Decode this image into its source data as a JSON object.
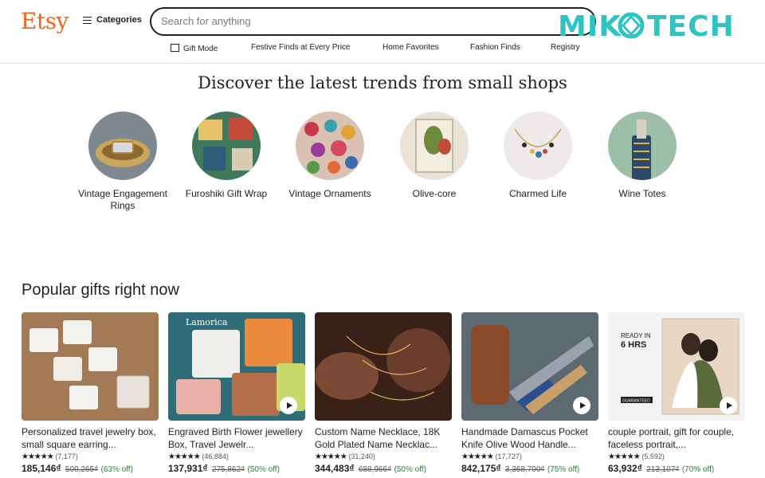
{
  "header": {
    "logo": "Etsy",
    "categories_label": "Categories",
    "search_placeholder": "Search for anything",
    "overlay_brand": "MIKO TECH"
  },
  "nav": {
    "items": [
      "Gift Mode",
      "Festive Finds at Every Price",
      "Home Favorites",
      "Fashion Finds",
      "Registry"
    ]
  },
  "trends": {
    "title": "Discover the latest trends from small shops",
    "items": [
      {
        "label": "Vintage Engagement Rings"
      },
      {
        "label": "Furoshiki Gift Wrap"
      },
      {
        "label": "Vintage Ornaments"
      },
      {
        "label": "Olive-core"
      },
      {
        "label": "Charmed Life"
      },
      {
        "label": "Wine Totes"
      }
    ]
  },
  "popular": {
    "title": "Popular gifts right now",
    "cards": [
      {
        "title": "Personalized travel jewelry box, small square earring...",
        "stars": "★★★★★",
        "reviews": "(7,177)",
        "price": "185,146₫",
        "was": "500,265₫",
        "off": "(63% off)",
        "has_video": false
      },
      {
        "title": "Engraved Birth Flower jewellery Box, Travel Jewelr...",
        "stars": "★★★★★",
        "reviews": "(46,884)",
        "price": "137,931₫",
        "was": "275,862₫",
        "off": "(50% off)",
        "has_video": true
      },
      {
        "title": "Custom Name Necklace, 18K Gold Plated Name Necklac...",
        "stars": "★★★★★",
        "reviews": "(31,240)",
        "price": "344,483₫",
        "was": "688,966₫",
        "off": "(50% off)",
        "has_video": false
      },
      {
        "title": "Handmade Damascus Pocket Knife Olive Wood Handle...",
        "stars": "★★★★★",
        "reviews": "(17,727)",
        "price": "842,175₫",
        "was": "3,368,700₫",
        "off": "(75% off)",
        "has_video": true
      },
      {
        "title": "couple portrait, gift for couple, faceless portrait,...",
        "stars": "★★★★★",
        "reviews": "(5,592)",
        "price": "63,932₫",
        "was": "213,107₫",
        "off": "(70% off)",
        "has_video": true
      }
    ]
  },
  "image_text": {
    "lamorica": "Lamorica",
    "ready_in": "READY IN",
    "hrs": "6 HRS",
    "guaranteed": "GUARANTEED"
  }
}
